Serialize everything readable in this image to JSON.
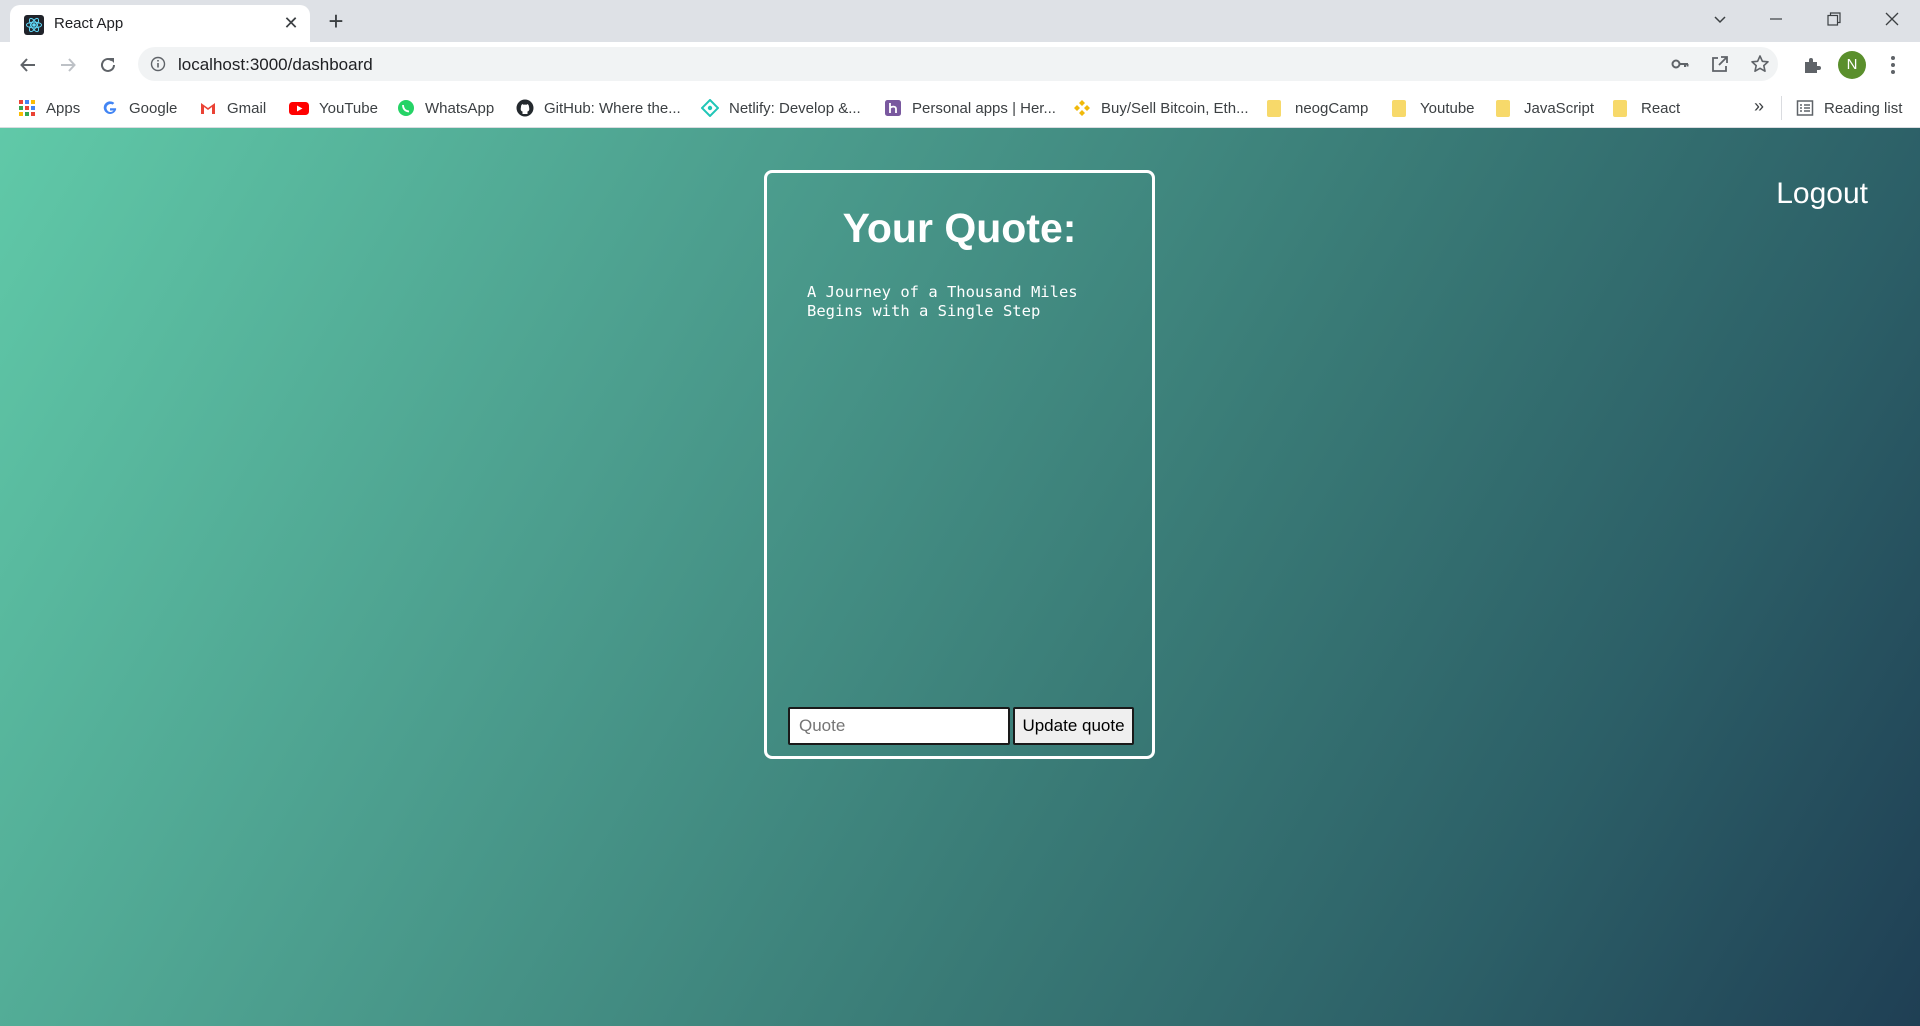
{
  "browser": {
    "tab": {
      "title": "React App",
      "close": "✕",
      "new_tab": "+"
    },
    "address_bar": {
      "url": "localhost:3000/dashboard"
    },
    "profile": {
      "initial": "N"
    },
    "bookmarks": [
      {
        "label": "Apps",
        "icon": "apps-grid-icon"
      },
      {
        "label": "Google",
        "icon": "google-icon"
      },
      {
        "label": "Gmail",
        "icon": "gmail-icon"
      },
      {
        "label": "YouTube",
        "icon": "youtube-icon"
      },
      {
        "label": "WhatsApp",
        "icon": "whatsapp-icon"
      },
      {
        "label": "GitHub: Where the...",
        "icon": "github-icon"
      },
      {
        "label": "Netlify: Develop &...",
        "icon": "netlify-icon"
      },
      {
        "label": "Personal apps | Her...",
        "icon": "heroku-icon"
      },
      {
        "label": "Buy/Sell Bitcoin, Eth...",
        "icon": "binance-icon"
      },
      {
        "label": "neogCamp",
        "icon": "folder-icon"
      },
      {
        "label": "Youtube",
        "icon": "folder-icon"
      },
      {
        "label": "JavaScript",
        "icon": "folder-icon"
      },
      {
        "label": "React",
        "icon": "folder-icon"
      }
    ],
    "bookmarks_more": "»",
    "reading_list": "Reading list"
  },
  "page": {
    "logout_label": "Logout",
    "card": {
      "title": "Your Quote:",
      "quote": "A Journey of a Thousand Miles\nBegins with a Single Step",
      "input_placeholder": "Quote",
      "input_value": "",
      "button_label": "Update quote"
    }
  },
  "colors": {
    "gradient_start": "#60c9a8",
    "gradient_end": "#1f3f54",
    "card_border": "#ffffff",
    "text": "#ffffff"
  }
}
